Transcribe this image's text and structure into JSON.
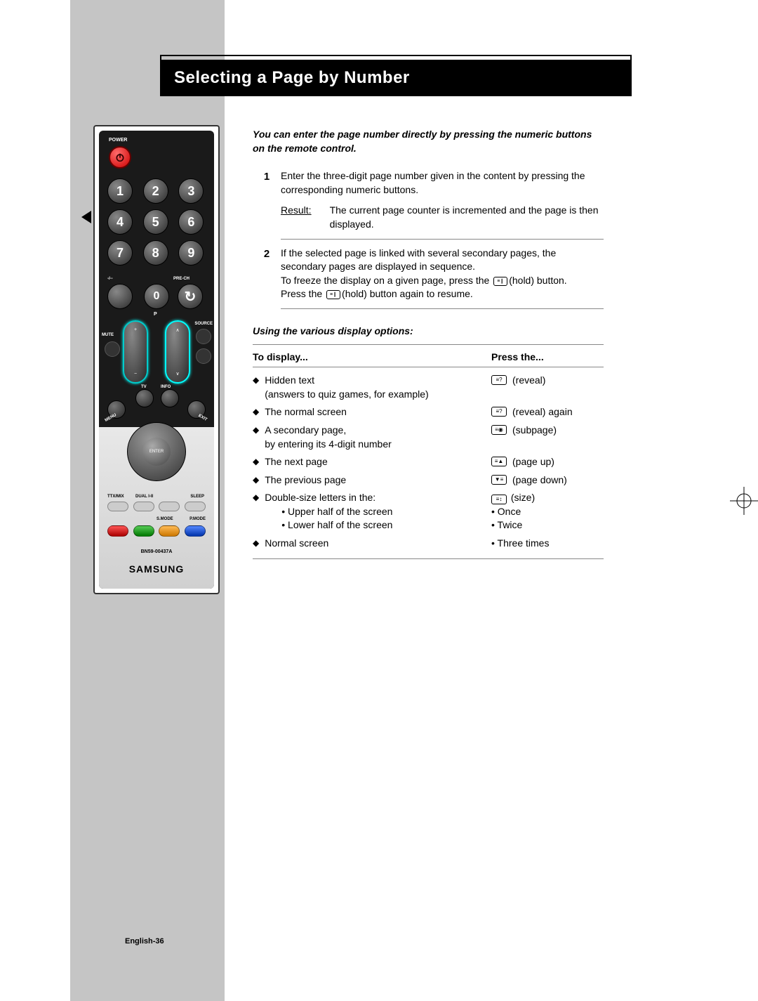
{
  "title": "Selecting a Page by Number",
  "intro": "You can enter the page number directly by pressing the numeric buttons on the remote control.",
  "steps": [
    {
      "num": "1",
      "text": "Enter the three-digit page number given in the content by pressing the corresponding numeric buttons.",
      "result_label": "Result:",
      "result_text": "The current page counter is incremented and the page is then displayed."
    },
    {
      "num": "2",
      "text_a": "If the selected page is linked with several secondary pages, the secondary pages are displayed in sequence.",
      "text_b_pre": "To freeze the display on a given page, press the ",
      "text_b_post": "(hold) button.",
      "text_c_pre": "Press the ",
      "text_c_post": "(hold) button again to resume."
    }
  ],
  "subhead": "Using the various display options:",
  "table": {
    "col1": "To display...",
    "col2": "Press the...",
    "rows": [
      {
        "left": "Hidden text",
        "left_sub": "(answers to quiz games, for example)",
        "icon": "≡?",
        "right": "(reveal)"
      },
      {
        "left": "The normal screen",
        "icon": "≡?",
        "right": "(reveal) again"
      },
      {
        "left": "A secondary page,",
        "left_sub": "by entering its 4-digit number",
        "icon": "≡◉",
        "right": "(subpage)"
      },
      {
        "left": "The next page",
        "icon": "≡▲",
        "right": "(page up)"
      },
      {
        "left": "The previous page",
        "icon": "▼≡",
        "right": "(page down)"
      },
      {
        "left": "Double-size letters in the:",
        "subs": [
          "Upper half of the screen",
          "Lower half of the screen"
        ],
        "icon": "≡↕",
        "right": "(size)",
        "right_subs": [
          "Once",
          "Twice"
        ]
      },
      {
        "left": "Normal screen",
        "right_subs": [
          "Three times"
        ]
      }
    ]
  },
  "remote": {
    "power_label": "POWER",
    "nums": [
      "1",
      "2",
      "3",
      "4",
      "5",
      "6",
      "7",
      "8",
      "9"
    ],
    "zero": "0",
    "dash": "-/--",
    "prech": "PRE-CH",
    "mute": "MUTE",
    "source": "SOURCE",
    "p_label": "P",
    "menu": "MENU",
    "tv": "TV",
    "info": "INFO",
    "exit": "EXIT",
    "enter": "ENTER",
    "ttx": "TTX/MIX",
    "dual": "DUAL I-II",
    "sleep": "SLEEP",
    "smode": "S.MODE",
    "pmode": "P.MODE",
    "model": "BN59-00437A",
    "brand": "SAMSUNG"
  },
  "page_num": "English-36"
}
